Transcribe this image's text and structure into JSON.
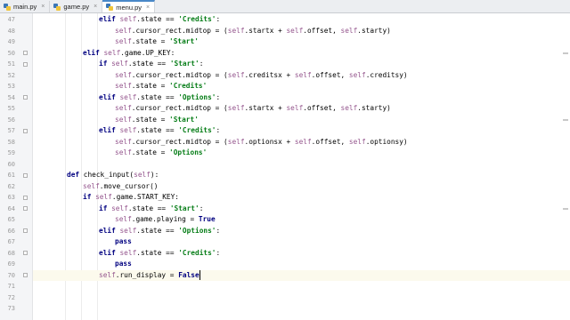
{
  "tabs": [
    {
      "label": "main.py",
      "active": false
    },
    {
      "label": "game.py",
      "active": false
    },
    {
      "label": "menu.py",
      "active": true
    }
  ],
  "lines": [
    {
      "n": "47",
      "indent": 3,
      "tokens": [
        [
          "kw",
          "elif "
        ],
        [
          "slf",
          "self"
        ],
        [
          "",
          "."
        ],
        [
          "",
          "state == "
        ],
        [
          "str",
          "'Credits'"
        ],
        [
          "",
          ":"
        ]
      ]
    },
    {
      "n": "48",
      "indent": 4,
      "tokens": [
        [
          "slf",
          "self"
        ],
        [
          "",
          ".cursor_rect.midtop = ("
        ],
        [
          "slf",
          "self"
        ],
        [
          "",
          ".startx + "
        ],
        [
          "slf",
          "self"
        ],
        [
          "",
          ".offset, "
        ],
        [
          "slf",
          "self"
        ],
        [
          "",
          ".starty)"
        ]
      ]
    },
    {
      "n": "49",
      "indent": 4,
      "tokens": [
        [
          "slf",
          "self"
        ],
        [
          "",
          ".state = "
        ],
        [
          "str",
          "'Start'"
        ]
      ]
    },
    {
      "n": "50",
      "indent": 2,
      "tokens": [
        [
          "kw",
          "elif "
        ],
        [
          "slf",
          "self"
        ],
        [
          "",
          ".game.UP_KEY:"
        ]
      ]
    },
    {
      "n": "51",
      "indent": 3,
      "tokens": [
        [
          "kw",
          "if "
        ],
        [
          "slf",
          "self"
        ],
        [
          "",
          ".state == "
        ],
        [
          "str",
          "'Start'"
        ],
        [
          "",
          ":"
        ]
      ]
    },
    {
      "n": "52",
      "indent": 4,
      "tokens": [
        [
          "slf",
          "self"
        ],
        [
          "",
          ".cursor_rect.midtop = ("
        ],
        [
          "slf",
          "self"
        ],
        [
          "",
          ".creditsx + "
        ],
        [
          "slf",
          "self"
        ],
        [
          "",
          ".offset, "
        ],
        [
          "slf",
          "self"
        ],
        [
          "",
          ".creditsy)"
        ]
      ]
    },
    {
      "n": "53",
      "indent": 4,
      "tokens": [
        [
          "slf",
          "self"
        ],
        [
          "",
          ".state = "
        ],
        [
          "str",
          "'Credits'"
        ]
      ]
    },
    {
      "n": "54",
      "indent": 3,
      "tokens": [
        [
          "kw",
          "elif "
        ],
        [
          "slf",
          "self"
        ],
        [
          "",
          ".state == "
        ],
        [
          "str",
          "'Options'"
        ],
        [
          "",
          ":"
        ]
      ]
    },
    {
      "n": "55",
      "indent": 4,
      "tokens": [
        [
          "slf",
          "self"
        ],
        [
          "",
          ".cursor_rect.midtop = ("
        ],
        [
          "slf",
          "self"
        ],
        [
          "",
          ".startx + "
        ],
        [
          "slf",
          "self"
        ],
        [
          "",
          ".offset, "
        ],
        [
          "slf",
          "self"
        ],
        [
          "",
          ".starty)"
        ]
      ]
    },
    {
      "n": "56",
      "indent": 4,
      "tokens": [
        [
          "slf",
          "self"
        ],
        [
          "",
          ".state = "
        ],
        [
          "str",
          "'Start'"
        ]
      ]
    },
    {
      "n": "57",
      "indent": 3,
      "tokens": [
        [
          "kw",
          "elif "
        ],
        [
          "slf",
          "self"
        ],
        [
          "",
          ".state == "
        ],
        [
          "str",
          "'Credits'"
        ],
        [
          "",
          ":"
        ]
      ]
    },
    {
      "n": "58",
      "indent": 4,
      "tokens": [
        [
          "slf",
          "self"
        ],
        [
          "",
          ".cursor_rect.midtop = ("
        ],
        [
          "slf",
          "self"
        ],
        [
          "",
          ".optionsx + "
        ],
        [
          "slf",
          "self"
        ],
        [
          "",
          ".offset, "
        ],
        [
          "slf",
          "self"
        ],
        [
          "",
          ".optionsy)"
        ]
      ]
    },
    {
      "n": "59",
      "indent": 4,
      "tokens": [
        [
          "slf",
          "self"
        ],
        [
          "",
          ".state = "
        ],
        [
          "str",
          "'Options'"
        ]
      ]
    },
    {
      "n": "60",
      "indent": 0,
      "tokens": []
    },
    {
      "n": "61",
      "indent": 1,
      "tokens": [
        [
          "kw",
          "def "
        ],
        [
          "",
          "check_input("
        ],
        [
          "slf",
          "self"
        ],
        [
          "",
          "):"
        ]
      ]
    },
    {
      "n": "62",
      "indent": 2,
      "tokens": [
        [
          "slf",
          "self"
        ],
        [
          "",
          ".move_cursor()"
        ]
      ]
    },
    {
      "n": "63",
      "indent": 2,
      "tokens": [
        [
          "kw",
          "if "
        ],
        [
          "slf",
          "self"
        ],
        [
          "",
          ".game.START_KEY:"
        ]
      ]
    },
    {
      "n": "64",
      "indent": 3,
      "tokens": [
        [
          "kw",
          "if "
        ],
        [
          "slf",
          "self"
        ],
        [
          "",
          ".state == "
        ],
        [
          "str",
          "'Start'"
        ],
        [
          "",
          ":"
        ]
      ]
    },
    {
      "n": "65",
      "indent": 4,
      "tokens": [
        [
          "slf",
          "self"
        ],
        [
          "",
          ".game.playing = "
        ],
        [
          "kw",
          "True"
        ]
      ]
    },
    {
      "n": "66",
      "indent": 3,
      "tokens": [
        [
          "kw",
          "elif "
        ],
        [
          "slf",
          "self"
        ],
        [
          "",
          ".state == "
        ],
        [
          "str",
          "'Options'"
        ],
        [
          "",
          ":"
        ]
      ]
    },
    {
      "n": "67",
      "indent": 4,
      "tokens": [
        [
          "kw",
          "pass"
        ]
      ]
    },
    {
      "n": "68",
      "indent": 3,
      "tokens": [
        [
          "kw",
          "elif "
        ],
        [
          "slf",
          "self"
        ],
        [
          "",
          ".state == "
        ],
        [
          "str",
          "'Credits'"
        ],
        [
          "",
          ":"
        ]
      ]
    },
    {
      "n": "69",
      "indent": 4,
      "tokens": [
        [
          "kw",
          "pass"
        ]
      ]
    },
    {
      "n": "70",
      "indent": 3,
      "tokens": [
        [
          "slf",
          "self"
        ],
        [
          "",
          ".run_display = "
        ],
        [
          "kw",
          "False"
        ]
      ],
      "current": true
    },
    {
      "n": "71",
      "indent": 0,
      "tokens": []
    },
    {
      "n": "72",
      "indent": 0,
      "tokens": []
    },
    {
      "n": "73",
      "indent": 0,
      "tokens": []
    }
  ],
  "fold_lines": [
    "50",
    "51",
    "54",
    "57",
    "61",
    "63",
    "64",
    "66",
    "68",
    "70"
  ]
}
